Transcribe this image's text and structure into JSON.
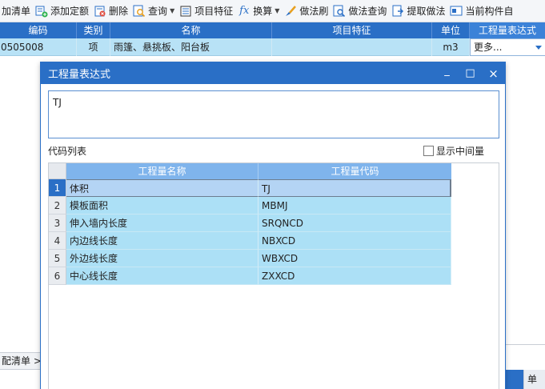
{
  "toolbar": {
    "items": [
      {
        "label": "加清单",
        "icon": "list-icon"
      },
      {
        "label": "添加定额",
        "icon": "add-quota-icon"
      },
      {
        "label": "删除",
        "icon": "delete-icon"
      },
      {
        "label": "查询",
        "icon": "query-icon"
      },
      {
        "label": "项目特征",
        "icon": "feature-icon"
      },
      {
        "label": "换算",
        "icon": "fx-icon"
      },
      {
        "label": "做法刷",
        "icon": "brush-icon"
      },
      {
        "label": "做法查询",
        "icon": "method-query-icon"
      },
      {
        "label": "提取做法",
        "icon": "extract-icon"
      },
      {
        "label": "当前构件自",
        "icon": "component-icon"
      }
    ]
  },
  "grid": {
    "columns": [
      "编码",
      "类别",
      "名称",
      "项目特征",
      "单位",
      "工程量表达式"
    ],
    "row": {
      "code": "0505008",
      "category": "项",
      "name": "雨篷、悬挑板、阳台板",
      "feature": "",
      "unit": "m3",
      "expr": "更多..."
    }
  },
  "bottom": {
    "tab_label": "配清单",
    "tab_arrow": ">",
    "unit_label": "单位"
  },
  "dialog": {
    "title": "工程量表达式",
    "btn_min": "_",
    "btn_max": "□",
    "btn_close": "×",
    "expression": "TJ",
    "code_list_label": "代码列表",
    "show_intermediate_label": "显示中间量",
    "table": {
      "headers": [
        "工程量名称",
        "工程量代码"
      ],
      "rows": [
        {
          "idx": "1",
          "name": "体积",
          "code": "TJ"
        },
        {
          "idx": "2",
          "name": "模板面积",
          "code": "MBMJ"
        },
        {
          "idx": "3",
          "name": "伸入墙内长度",
          "code": "SRQNCD"
        },
        {
          "idx": "4",
          "name": "内边线长度",
          "code": "NBXCD"
        },
        {
          "idx": "5",
          "name": "外边线长度",
          "code": "WBXCD"
        },
        {
          "idx": "6",
          "name": "中心线长度",
          "code": "ZXXCD"
        }
      ]
    }
  },
  "colors": {
    "accent": "#2a6fc6",
    "row_fill": "#ace0f6",
    "header_fill": "#7fb4ec"
  }
}
